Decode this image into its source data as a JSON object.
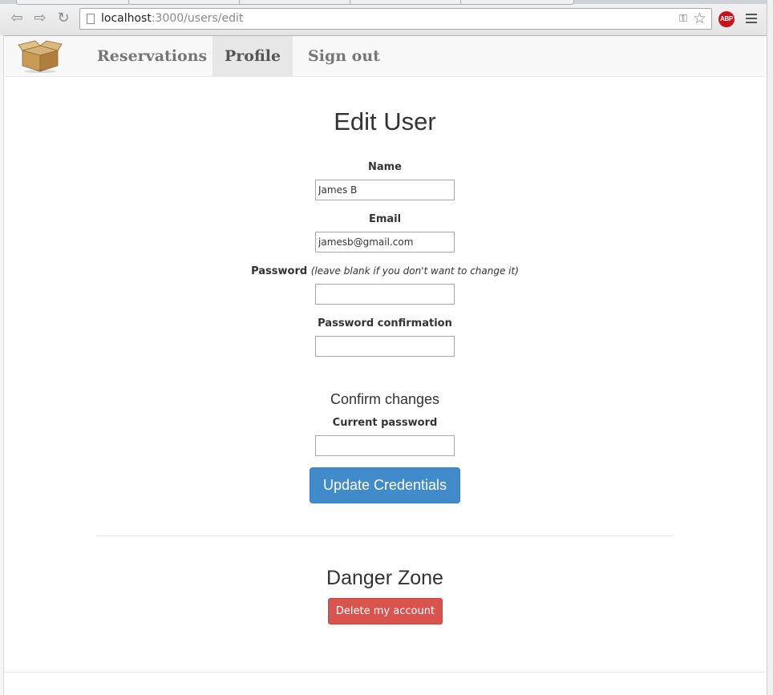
{
  "browser": {
    "url_host": "localhost",
    "url_path": ":3000/users/edit",
    "icons": [
      "back-icon",
      "forward-icon",
      "reload-icon",
      "page-icon",
      "key-icon",
      "star-icon",
      "adblock-icon",
      "menu-icon"
    ],
    "abp_label": "ABP"
  },
  "navbar": {
    "logo_icon": "box-icon",
    "items": [
      {
        "label": "Reservations",
        "active": false
      },
      {
        "label": "Profile",
        "active": true
      },
      {
        "label": "Sign out",
        "active": false
      }
    ]
  },
  "form": {
    "title": "Edit User",
    "name_label": "Name",
    "name_value": "James B",
    "email_label": "Email",
    "email_value": "jamesb@gmail.com",
    "password_label": "Password",
    "password_hint": "(leave blank if you don't want to change it)",
    "password_value": "",
    "password_confirmation_label": "Password confirmation",
    "password_confirmation_value": "",
    "confirm_heading": "Confirm changes",
    "current_password_label": "Current password",
    "current_password_value": "",
    "submit_label": "Update Credentials"
  },
  "danger": {
    "heading": "Danger Zone",
    "delete_label": "Delete my account"
  },
  "colors": {
    "primary": "#428bca",
    "danger": "#d9534f",
    "navbar_bg": "#f8f8f8",
    "active_nav_bg": "#e7e7e7"
  }
}
